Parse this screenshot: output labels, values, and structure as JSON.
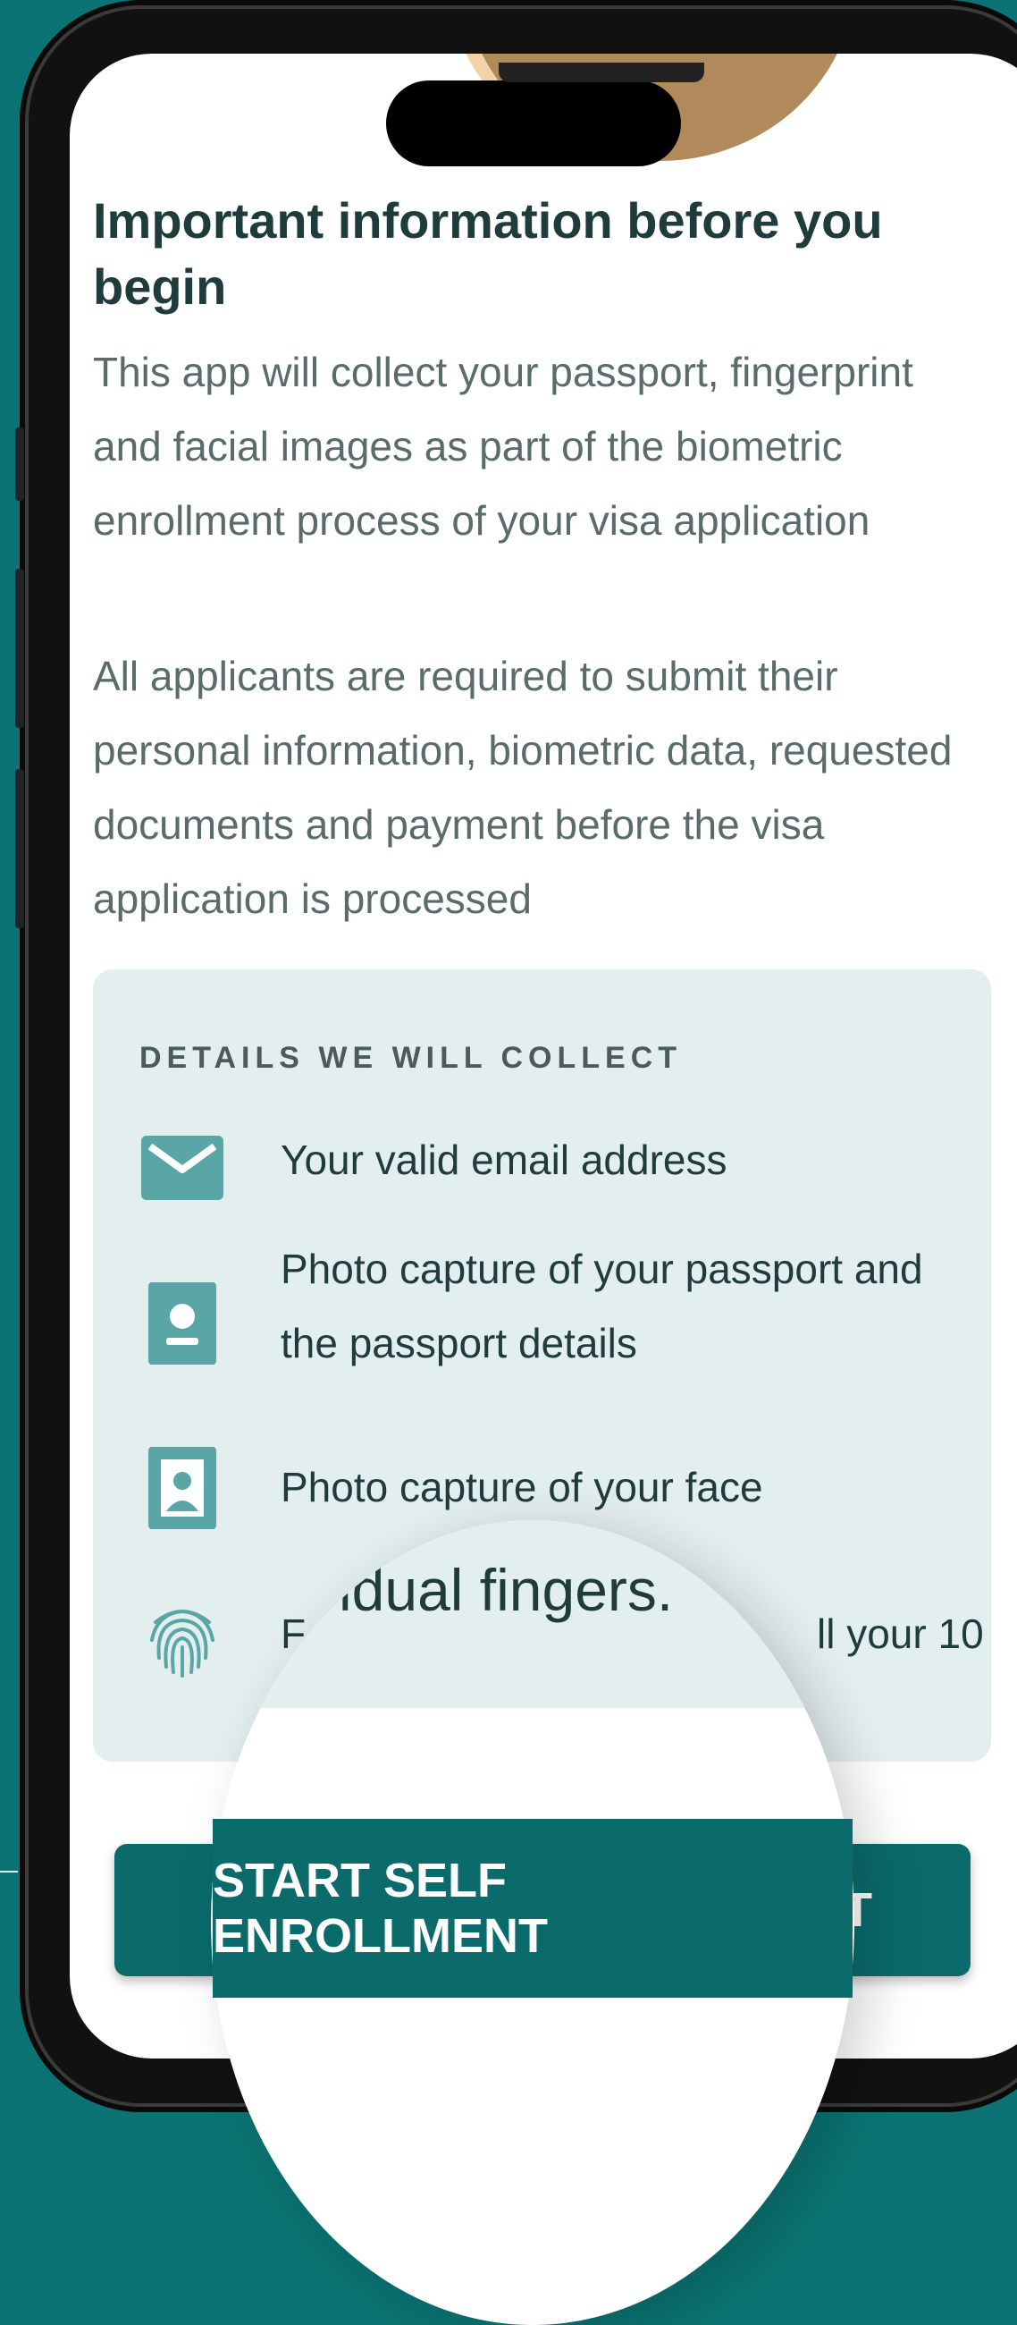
{
  "onboarding": {
    "title": "Important information before you begin",
    "intro_1": "This app will collect your passport, fingerprint and facial images as part of the biometric enrollment process of your visa application",
    "intro_2": "All applicants are required to submit their personal information, biometric data, requested documents and payment before the visa application is processed"
  },
  "details_card": {
    "heading": "DETAILS WE WILL COLLECT",
    "items": [
      {
        "icon": "email-icon",
        "text": "Your valid email address"
      },
      {
        "icon": "passport-icon",
        "text": "Photo capture of your passport and the passport details"
      },
      {
        "icon": "face-photo-icon",
        "text": "Photo capture of your face"
      },
      {
        "icon": "fingerprint-icon",
        "text": "F",
        "tail": "ll your 10"
      }
    ]
  },
  "magnifier": {
    "text": "vidual fingers."
  },
  "actions": {
    "start_label": "START SELF ENROLLMENT"
  },
  "colors": {
    "background": "#0b7373",
    "primary": "#0b6b6b",
    "card": "#e3eeee",
    "icon": "#5aa5a5"
  }
}
